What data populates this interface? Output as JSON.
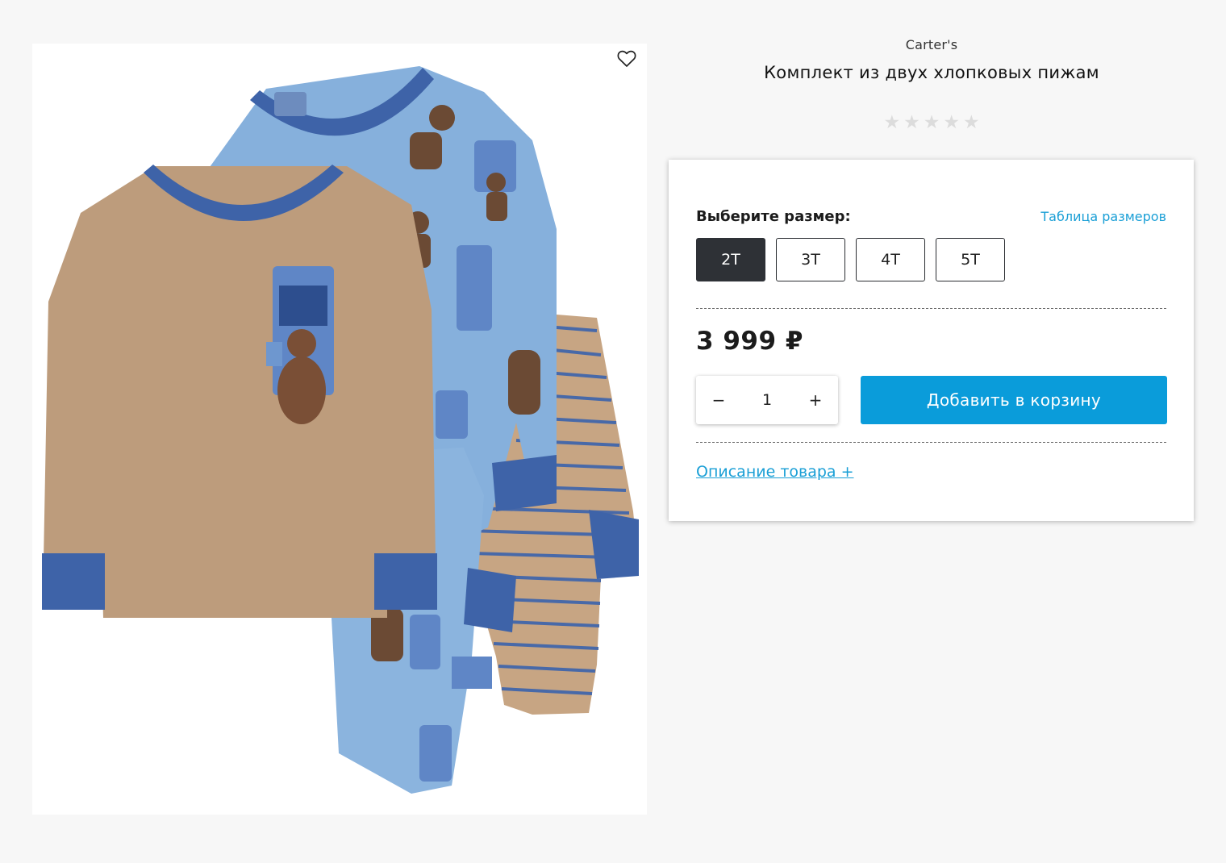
{
  "product": {
    "brand": "Carter's",
    "title": "Комплект из двух хлопковых пижам",
    "rating_stars": [
      "★",
      "★",
      "★",
      "★",
      "★"
    ],
    "image_icon": "pajama-set-photo"
  },
  "wishlist": {
    "icon": "heart-outline-icon"
  },
  "buy_box": {
    "size_label": "Выберите размер:",
    "size_chart_link": "Таблица размеров",
    "sizes": [
      {
        "label": "2T",
        "selected": true
      },
      {
        "label": "3T",
        "selected": false
      },
      {
        "label": "4T",
        "selected": false
      },
      {
        "label": "5T",
        "selected": false
      }
    ],
    "price": "3 999 ₽",
    "quantity": {
      "minus": "−",
      "value": "1",
      "plus": "+"
    },
    "add_to_cart": "Добавить в корзину",
    "description_link": "Описание товара +"
  },
  "colors": {
    "accent_blue": "#0a9cda",
    "link_blue": "#1a9fd6",
    "selected_size_bg": "#2e3136",
    "star_empty": "#dcdcdc"
  }
}
